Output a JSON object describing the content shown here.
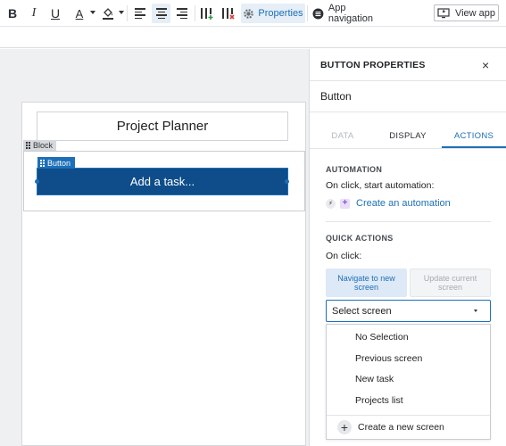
{
  "toolbar": {
    "bold": "B",
    "italic": "I",
    "underline": "U",
    "text_color": "A",
    "properties_label": "Properties",
    "app_navigation_label": "App navigation",
    "view_app_label": "View app"
  },
  "canvas": {
    "title": "Project Planner",
    "block_tag": "Block",
    "button_tag": "Button",
    "button_text": "Add a task..."
  },
  "panel": {
    "title": "BUTTON PROPERTIES",
    "close": "×",
    "name_value": "Button",
    "tabs": [
      {
        "label": "DATA",
        "state": "disabled"
      },
      {
        "label": "DISPLAY",
        "state": "normal"
      },
      {
        "label": "ACTIONS",
        "state": "active"
      }
    ],
    "automation": {
      "section_title": "AUTOMATION",
      "description": "On click, start automation:",
      "link": "Create an automation"
    },
    "quick_actions": {
      "section_title": "QUICK ACTIONS",
      "on_click": "On click:",
      "navigate_label": "Navigate to new screen",
      "update_label": "Update current screen",
      "select_value": "Select screen",
      "options": [
        "No Selection",
        "Previous screen",
        "New task",
        "Projects list"
      ],
      "create_label": "Create a new screen"
    }
  },
  "colors": {
    "accent": "#1d6fb8",
    "canvas_button": "#0e4d8a",
    "canvas_bg": "#eef0f2"
  }
}
